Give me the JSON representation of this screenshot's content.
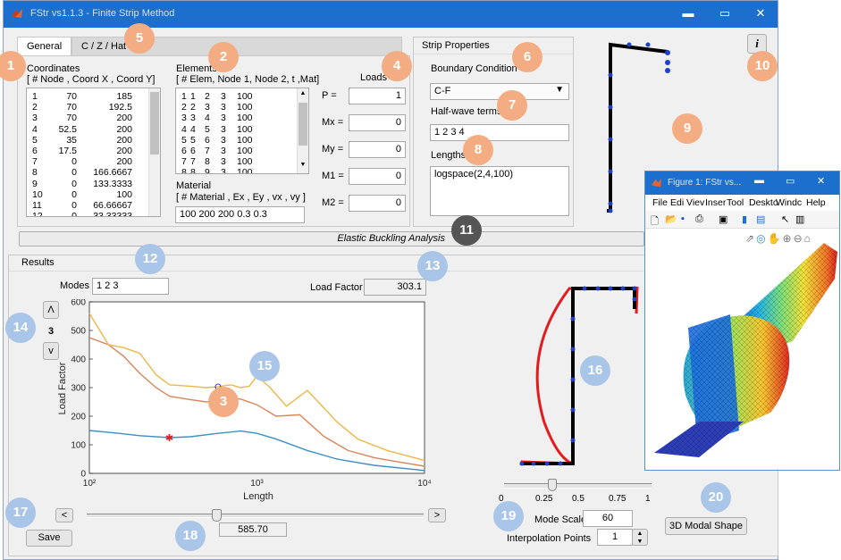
{
  "window": {
    "title": "FStr vs1.1.3  -  Finite Strip Method",
    "minimize": "▬",
    "maximize": "▭",
    "close": "✕"
  },
  "tabs": [
    {
      "label": "General"
    },
    {
      "label": "C / Z / Hat"
    }
  ],
  "coordinates": {
    "title": "Coordinates",
    "header": "[ # Node ,  Coord X ,  Coord Y]",
    "rows": [
      [
        "1",
        "70",
        "185"
      ],
      [
        "2",
        "70",
        "192.5"
      ],
      [
        "3",
        "70",
        "200"
      ],
      [
        "4",
        "52.5",
        "200"
      ],
      [
        "5",
        "35",
        "200"
      ],
      [
        "6",
        "17.5",
        "200"
      ],
      [
        "7",
        "0",
        "200"
      ],
      [
        "8",
        "0",
        "166.6667"
      ],
      [
        "9",
        "0",
        "133.3333"
      ],
      [
        "10",
        "0",
        "100"
      ],
      [
        "11",
        "0",
        "66.66667"
      ],
      [
        "12",
        "0",
        "33.33333"
      ]
    ]
  },
  "elements": {
    "title": "Elements",
    "header": "[ # Elem, Node 1, Node 2, t ,Mat]",
    "rows": [
      [
        "1",
        "1",
        "2",
        "3",
        "100"
      ],
      [
        "2",
        "2",
        "3",
        "3",
        "100"
      ],
      [
        "3",
        "3",
        "4",
        "3",
        "100"
      ],
      [
        "4",
        "4",
        "5",
        "3",
        "100"
      ],
      [
        "5",
        "5",
        "6",
        "3",
        "100"
      ],
      [
        "6",
        "6",
        "7",
        "3",
        "100"
      ],
      [
        "7",
        "7",
        "8",
        "3",
        "100"
      ],
      [
        "8",
        "8",
        "9",
        "3",
        "100"
      ]
    ]
  },
  "material": {
    "title": "Material",
    "header": "[ # Material , Ex , Ey , vx , vy ]",
    "value": "100  200  200  0.3  0.3"
  },
  "loads": {
    "title": "Loads",
    "items": [
      {
        "label": "P =",
        "value": "1"
      },
      {
        "label": "Mx =",
        "value": "0"
      },
      {
        "label": "My =",
        "value": "0"
      },
      {
        "label": "M1 =",
        "value": "0"
      },
      {
        "label": "M2 =",
        "value": "0"
      }
    ]
  },
  "strip": {
    "title": "Strip Properties",
    "boundary_label": "Boundary Condition",
    "boundary_value": "C-F",
    "halfwave_label": "Half-wave terms",
    "halfwave_value": "1 2 3 4",
    "lengths_label": "Lengths",
    "lengths_value": "logspace(2,4,100)"
  },
  "info_button": "i",
  "analysis_button": "Elastic Buckling Analysis",
  "results": {
    "title": "Results",
    "modes_label": "Modes",
    "modes_value": "1 2 3",
    "load_factor_label": "Load Factor",
    "load_factor_value": "303.1",
    "mode_up": "Λ",
    "mode_num": "3",
    "mode_down": "v",
    "prev": "<",
    "next": ">",
    "length_value": "585.70",
    "save": "Save",
    "mode_scale_label": "Mode Scale",
    "mode_scale_value": "60",
    "interp_label": "Interpolation Points",
    "interp_value": "1",
    "modal_button": "3D Modal Shape",
    "scale_ticks": [
      "0",
      "0.25",
      "0.5",
      "0.75",
      "1"
    ]
  },
  "chart_data": {
    "type": "line",
    "xlabel": "Length",
    "ylabel": "Load Factor",
    "xscale": "log",
    "xlim": [
      100,
      10000
    ],
    "ylim": [
      0,
      600
    ],
    "x_tick_labels": [
      "10²",
      "10³",
      "10⁴"
    ],
    "y_tick_labels": [
      "0",
      "100",
      "200",
      "300",
      "400",
      "500",
      "600"
    ],
    "colors": [
      "#3d8fc4",
      "#d9855a",
      "#ecb849"
    ],
    "series": [
      {
        "x": [
          100,
          150,
          200,
          300,
          400,
          585.7,
          800,
          1000,
          1300,
          2000,
          3000,
          5000,
          10000
        ],
        "values": [
          150,
          140,
          132,
          125,
          128,
          140,
          148,
          140,
          120,
          80,
          50,
          28,
          10
        ]
      },
      {
        "x": [
          100,
          130,
          160,
          200,
          250,
          300,
          400,
          500,
          585.7,
          700,
          800,
          1000,
          1300,
          1800,
          2500,
          3500,
          5000,
          7000,
          10000
        ],
        "values": [
          475,
          450,
          410,
          350,
          300,
          270,
          258,
          250,
          258,
          262,
          260,
          240,
          200,
          205,
          130,
          80,
          55,
          40,
          25
        ]
      },
      {
        "x": [
          100,
          130,
          160,
          200,
          250,
          300,
          400,
          500,
          585.7,
          700,
          800,
          900,
          1000,
          1200,
          1500,
          2000,
          2500,
          3000,
          4000,
          6000,
          10000
        ],
        "values": [
          560,
          450,
          440,
          420,
          345,
          310,
          305,
          300,
          303.1,
          310,
          300,
          305,
          340,
          300,
          235,
          290,
          230,
          180,
          120,
          80,
          45
        ]
      }
    ],
    "markers": [
      {
        "series": 0,
        "x": 300,
        "y": 125,
        "symbol": "star"
      },
      {
        "series": 2,
        "x": 585.7,
        "y": 303.1,
        "symbol": "circle"
      }
    ]
  },
  "figure": {
    "title": "Figure 1: FStr vs...",
    "menu": [
      "File",
      "Edi",
      "Viev",
      "Inser",
      "Tool",
      "Deskto",
      "Windc",
      "Help"
    ]
  },
  "badges": [
    "1",
    "2",
    "3",
    "4",
    "5",
    "6",
    "7",
    "8",
    "9",
    "10",
    "11",
    "12",
    "13",
    "14",
    "15",
    "16",
    "17",
    "18",
    "19",
    "20"
  ]
}
